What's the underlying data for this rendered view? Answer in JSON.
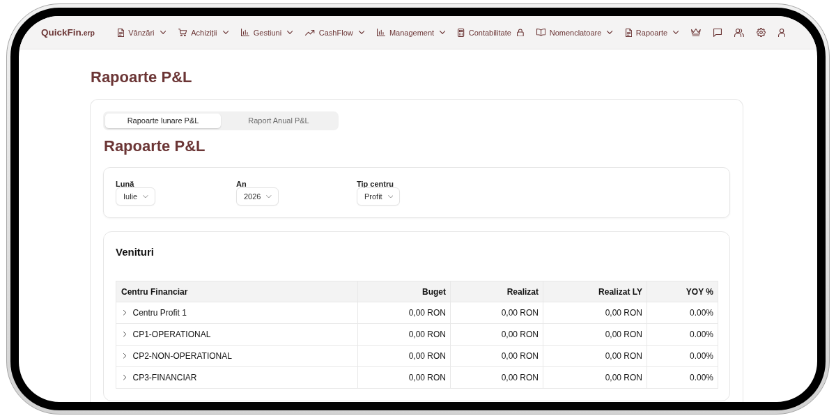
{
  "navbar": {
    "logo": {
      "name": "QuickFin",
      "suffix": ".erp"
    },
    "menu": [
      {
        "label": "Vânzări",
        "locked": false
      },
      {
        "label": "Achiziții",
        "locked": false
      },
      {
        "label": "Gestiuni",
        "locked": false
      },
      {
        "label": "CashFlow",
        "locked": false
      },
      {
        "label": "Management",
        "locked": false
      },
      {
        "label": "Contabilitate",
        "locked": true
      },
      {
        "label": "Nomenclatoare",
        "locked": false
      },
      {
        "label": "Rapoarte",
        "locked": false
      }
    ]
  },
  "page_title": "Rapoarte P&L",
  "report": {
    "tabs": [
      {
        "label": "Rapoarte lunare P&L",
        "selected": true
      },
      {
        "label": "Raport Anual P&L",
        "selected": false
      }
    ],
    "title": "Rapoarte P&L",
    "filters": [
      {
        "label": "Lună",
        "value": "Iulie"
      },
      {
        "label": "An",
        "value": "2026"
      },
      {
        "label": "Tip centru",
        "value": "Profit"
      }
    ],
    "section": {
      "title": "Venituri",
      "columns": [
        "Centru Financiar",
        "Buget",
        "Realizat",
        "Realizat LY",
        "YOY %"
      ],
      "rows": [
        {
          "expanded": false,
          "cells": [
            "Centru Profit 1",
            "0,00 RON",
            "0,00 RON",
            "0,00 RON",
            "0.00%"
          ]
        },
        {
          "expanded": false,
          "cells": [
            "CP1-OPERATIONAL",
            "0,00 RON",
            "0,00 RON",
            "0,00 RON",
            "0.00%"
          ]
        },
        {
          "expanded": false,
          "cells": [
            "CP2-NON-OPERATIONAL",
            "0,00 RON",
            "0,00 RON",
            "0,00 RON",
            "0.00%"
          ]
        },
        {
          "expanded": false,
          "cells": [
            "CP3-FINANCIAR",
            "0,00 RON",
            "0,00 RON",
            "0,00 RON",
            "0.00%"
          ]
        }
      ]
    }
  }
}
